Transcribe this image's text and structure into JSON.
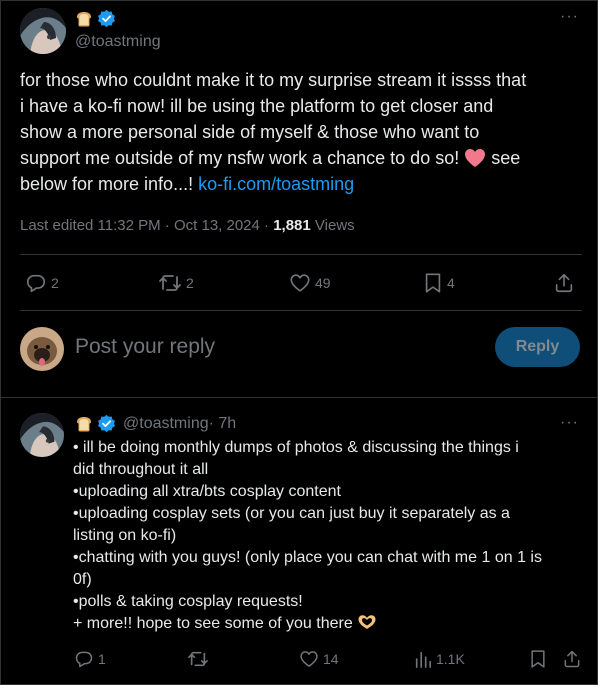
{
  "post": {
    "handle": "@toastming",
    "lines": [
      "for those who couldnt make it to my surprise stream it issss that",
      "i have a ko-fi now! ill be using the platform to get closer and",
      "show a more personal side of myself & those who want to",
      "support me outside of my nsfw work a chance to do so!",
      "see",
      "below for more info...!"
    ],
    "link": "ko-fi.com/toastming",
    "edited": "Last edited 11:32 PM · Oct 13, 2024 · ",
    "views_count": "1,881",
    "views_label": " Views",
    "actions": {
      "replies": "2",
      "reposts": "2",
      "likes": "49",
      "bookmarks": "4"
    }
  },
  "composer": {
    "placeholder": "Post your reply",
    "button": "Reply"
  },
  "reply": {
    "handle": "@toastming",
    "time": "· 7h",
    "lines": [
      "• ill be doing monthly dumps of photos & discussing the things i",
      "did throughout it all",
      "•uploading all xtra/bts cosplay content",
      "•uploading cosplay sets (or you can just buy it separately as a",
      "listing on ko-fi)",
      "•chatting with you guys! (only place you can chat with me 1 on 1 is",
      "0f)",
      "•polls & taking cosplay requests!",
      "+ more!! hope to see some of you there"
    ],
    "actions": {
      "replies": "1",
      "likes": "14",
      "views": "1.1K"
    }
  },
  "colors": {
    "background": "#000000",
    "text": "#e7e9ea",
    "muted": "#71767b",
    "accent": "#1d9bf0",
    "divider": "#2f3336"
  },
  "icons": [
    "toast-emoji",
    "verified-badge-icon",
    "more-icon",
    "reply-icon",
    "repost-icon",
    "like-icon",
    "bookmark-icon",
    "share-icon",
    "views-icon",
    "heart-emoji",
    "heart-hands-emoji"
  ]
}
